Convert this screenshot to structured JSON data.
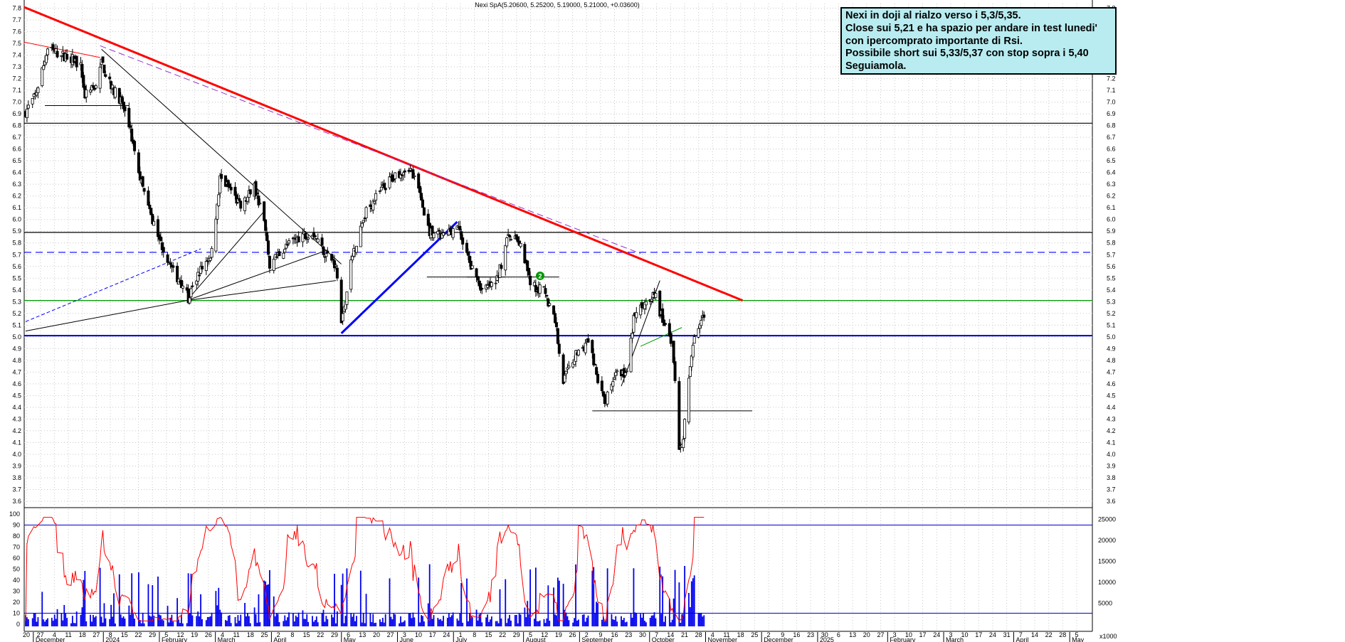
{
  "chart_data": {
    "type": "candlestick",
    "title": "Nexi SpA(5.20600, 5.25200, 5.19000, 5.21000, +0.03600)",
    "price_axis": {
      "min": 3.6,
      "max": 7.8,
      "step": 0.1,
      "tick_labels": [
        "3.6",
        "3.7",
        "3.8",
        "3.9",
        "4.0",
        "4.1",
        "4.2",
        "4.3",
        "4.4",
        "4.5",
        "4.6",
        "4.7",
        "4.8",
        "4.9",
        "5.0",
        "5.1",
        "5.2",
        "5.3",
        "5.4",
        "5.5",
        "5.6",
        "5.7",
        "5.8",
        "5.9",
        "6.0",
        "6.1",
        "6.2",
        "6.3",
        "6.4",
        "6.5",
        "6.6",
        "6.7",
        "6.8",
        "6.9",
        "7.0",
        "7.1",
        "7.2",
        "7.3",
        "7.4",
        "7.5",
        "7.6",
        "7.7",
        "7.8"
      ]
    },
    "rsi_axis": {
      "min": 0,
      "max": 100,
      "tick_labels": [
        "0",
        "10",
        "20",
        "30",
        "40",
        "50",
        "60",
        "70",
        "80",
        "90",
        "100"
      ],
      "levels": [
        10,
        90
      ]
    },
    "volume_axis": {
      "tick_labels": [
        "5000",
        "10000",
        "15000",
        "20000",
        "25000"
      ],
      "unit_label": "x1000"
    },
    "x_axis": {
      "day_labels": [
        "20",
        "27",
        "4",
        "11",
        "18",
        "27",
        "8",
        "15",
        "22",
        "29",
        "5",
        "12",
        "19",
        "26",
        "4",
        "11",
        "18",
        "25",
        "2",
        "8",
        "15",
        "22",
        "29",
        "6",
        "13",
        "20",
        "27",
        "3",
        "10",
        "17",
        "24",
        "1",
        "8",
        "15",
        "22",
        "29",
        "5",
        "12",
        "19",
        "26",
        "2",
        "9",
        "16",
        "23",
        "30",
        "7",
        "14",
        "21",
        "28",
        "4",
        "11",
        "18",
        "25",
        "2",
        "9",
        "16",
        "23",
        "30",
        "6",
        "13",
        "20",
        "27",
        "3",
        "10",
        "17",
        "24",
        "3",
        "10",
        "17",
        "24",
        "31",
        "7",
        "14",
        "22",
        "28",
        "5"
      ],
      "month_labels": [
        "December",
        "2024",
        "February",
        "March",
        "April",
        "May",
        "June",
        "July",
        "August",
        "September",
        "October",
        "November",
        "December",
        "2025",
        "February",
        "March",
        "April",
        "May"
      ]
    },
    "annotation_box": {
      "lines": [
        "Nexi in doji al rialzo verso i 5,3/5,35.",
        "Close sui 5,21 e ha spazio per andare in test lunedi'",
        "con ipercomprato importante di Rsi.",
        "Possibile short sui 5,33/5,37 con stop sopra i 5,40",
        "Seguiamola."
      ]
    },
    "marker_label": "2",
    "horizontal_levels": [
      {
        "price": 6.82,
        "color": "#000000",
        "style": "solid"
      },
      {
        "price": 5.89,
        "color": "#000000",
        "style": "solid"
      },
      {
        "price": 5.72,
        "color": "#0000ff",
        "style": "dashed"
      },
      {
        "price": 5.31,
        "color": "#009900",
        "style": "solid"
      },
      {
        "price": 5.01,
        "color": "#0000cc",
        "style": "solid"
      }
    ],
    "trendlines": [
      {
        "color": "#ff0000",
        "width": 3,
        "from": {
          "date": "2023-12-04",
          "price": 7.88
        },
        "to": {
          "date": "2025-05-23",
          "price": 5.31
        }
      },
      {
        "color": "#9933cc",
        "width": 1,
        "dash": true,
        "from": {
          "date": "2024-02-12",
          "price": 7.48
        },
        "to": {
          "date": "2025-03-10",
          "price": 5.71
        }
      },
      {
        "color": "#ff0000",
        "width": 1,
        "from": {
          "date": "2023-12-11",
          "price": 7.53
        },
        "to": {
          "date": "2024-02-12",
          "price": 7.38
        }
      },
      {
        "color": "#000000",
        "width": 1,
        "from": {
          "date": "2024-02-13",
          "price": 7.45
        },
        "to": {
          "date": "2024-08-05",
          "price": 5.62
        }
      },
      {
        "color": "#0000ff",
        "width": 3,
        "from": {
          "date": "2024-08-05",
          "price": 5.03
        },
        "to": {
          "date": "2024-10-28",
          "price": 5.98
        }
      },
      {
        "color": "#009900",
        "width": 1,
        "from": {
          "date": "2025-03-10",
          "price": 4.92
        },
        "to": {
          "date": "2025-04-09",
          "price": 5.08
        }
      }
    ],
    "ohlc_sample": [
      {
        "date": "2023-12-18",
        "close": 7.45
      },
      {
        "date": "2024-02-12",
        "close": 7.42
      },
      {
        "date": "2024-03-11",
        "close": 6.45
      },
      {
        "date": "2024-04-15",
        "close": 5.35
      },
      {
        "date": "2024-05-13",
        "close": 6.38
      },
      {
        "date": "2024-06-17",
        "close": 5.62
      },
      {
        "date": "2024-08-05",
        "close": 5.12
      },
      {
        "date": "2024-09-23",
        "close": 6.42
      },
      {
        "date": "2024-11-18",
        "close": 5.35
      },
      {
        "date": "2024-12-09",
        "close": 5.82
      },
      {
        "date": "2025-01-13",
        "close": 4.62
      },
      {
        "date": "2025-02-03",
        "close": 4.42
      },
      {
        "date": "2025-03-17",
        "close": 5.35
      },
      {
        "date": "2025-04-07",
        "close": 3.95
      },
      {
        "date": "2025-04-25",
        "close": 5.21
      }
    ]
  }
}
